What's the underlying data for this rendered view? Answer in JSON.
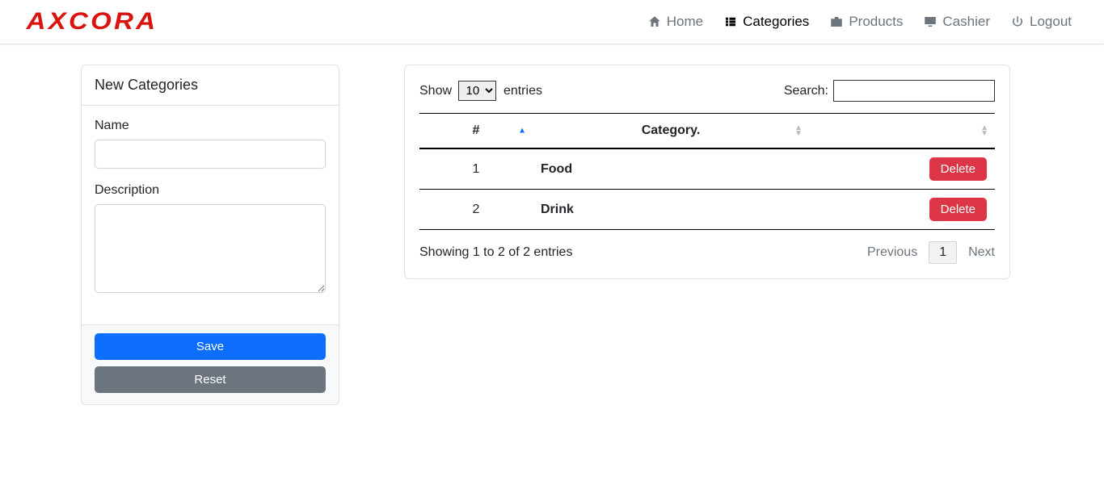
{
  "brand": "AXCORA",
  "nav": {
    "home": "Home",
    "categories": "Categories",
    "products": "Products",
    "cashier": "Cashier",
    "logout": "Logout"
  },
  "form": {
    "title": "New Categories",
    "name_label": "Name",
    "name_value": "",
    "desc_label": "Description",
    "desc_value": "",
    "save": "Save",
    "reset": "Reset"
  },
  "table": {
    "show": "Show",
    "entries": "entries",
    "per_page": "10",
    "search_label": "Search:",
    "search_value": "",
    "col_num": "#",
    "col_cat": "Category.",
    "rows": [
      {
        "n": "1",
        "name": "Food",
        "delete": "Delete"
      },
      {
        "n": "2",
        "name": "Drink",
        "delete": "Delete"
      }
    ],
    "info": "Showing 1 to 2 of 2 entries",
    "prev": "Previous",
    "page": "1",
    "next": "Next"
  }
}
